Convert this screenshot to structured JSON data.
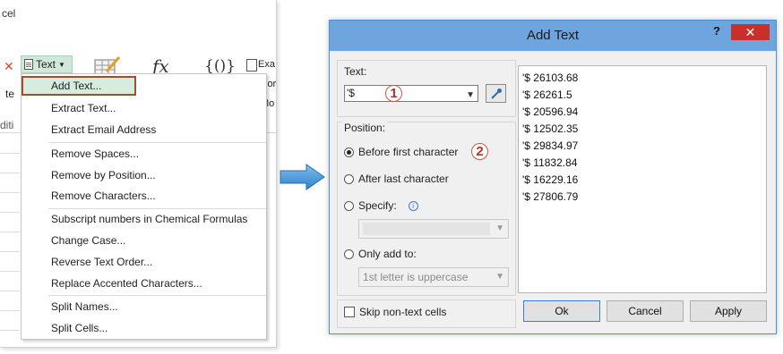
{
  "excel": {
    "title_fragment": "cel",
    "ribbon": {
      "text_button": "Text",
      "ribbon_label_1": "te",
      "ribbon_label_2": "diti",
      "right_label_1": "Exa",
      "right_label_2": "lor",
      "right_label_3": "Mo",
      "fx_icon": "fx",
      "braces_icon": "{()}"
    },
    "menu": {
      "items": [
        "Add Text...",
        "Extract Text...",
        "Extract Email Address",
        "Remove Spaces...",
        "Remove by Position...",
        "Remove Characters...",
        "Subscript numbers in Chemical Formulas",
        "Change Case...",
        "Reverse Text Order...",
        "Replace Accented Characters...",
        "Split Names...",
        "Split Cells..."
      ]
    }
  },
  "dialog": {
    "title": "Add Text",
    "help": "?",
    "close": "✕",
    "text_label": "Text:",
    "text_value": "'$",
    "position_label": "Position:",
    "options": {
      "before": "Before first character",
      "after": "After last character",
      "specify": "Specify:",
      "only_add": "Only add to:"
    },
    "only_add_value": "1st letter is uppercase",
    "specify_value": "",
    "skip_label": "Skip non-text cells",
    "preview": [
      "'$ 26103.68",
      "'$ 26261.5",
      "'$ 20596.94",
      "'$ 12502.35",
      "'$ 29834.97",
      "'$ 11832.84",
      "'$ 16229.16",
      "'$ 27806.79"
    ],
    "buttons": {
      "ok": "Ok",
      "cancel": "Cancel",
      "apply": "Apply"
    },
    "badges": {
      "one": "1",
      "two": "2"
    }
  },
  "colors": {
    "title_bar": "#6ea5df",
    "close": "#c9302c",
    "menu_highlight": "#d5ecde",
    "highlight_border": "#a84b2c",
    "arrow": "#3b8fd6"
  }
}
